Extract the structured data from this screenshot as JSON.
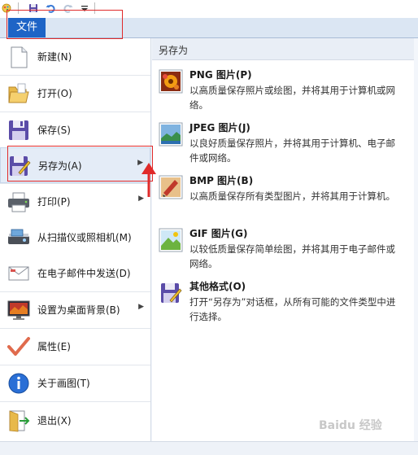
{
  "app": {
    "file_tab": "文件",
    "watermark": "Baidu 经验"
  },
  "quick_access": {
    "icons": [
      "paint-app-icon",
      "save-icon",
      "undo-icon",
      "redo-icon",
      "dropdown-icon"
    ]
  },
  "menu": {
    "items": [
      {
        "label": "新建(N)",
        "icon": "new-file-icon"
      },
      {
        "label": "打开(O)",
        "icon": "open-folder-icon"
      },
      {
        "label": "保存(S)",
        "icon": "save-icon"
      },
      {
        "label": "另存为(A)",
        "icon": "save-as-icon",
        "submenu": true
      },
      {
        "label": "打印(P)",
        "icon": "printer-icon",
        "submenu": true
      },
      {
        "label": "从扫描仪或照相机(M)",
        "icon": "scanner-icon"
      },
      {
        "label": "在电子邮件中发送(D)",
        "icon": "email-icon"
      },
      {
        "label": "设置为桌面背景(B)",
        "icon": "desktop-icon",
        "submenu": true
      },
      {
        "label": "属性(E)",
        "icon": "checkmark-icon"
      },
      {
        "label": "关于画图(T)",
        "icon": "info-icon"
      },
      {
        "label": "退出(X)",
        "icon": "exit-icon"
      }
    ]
  },
  "save_as": {
    "heading": "另存为",
    "options": [
      {
        "title": "PNG 图片(P)",
        "desc": "以高质量保存照片或绘图，并将其用于计算机或网络。",
        "icon": "png-image-icon"
      },
      {
        "title": "JPEG 图片(J)",
        "desc": "以良好质量保存照片，并将其用于计算机、电子邮件或网络。",
        "icon": "jpeg-image-icon"
      },
      {
        "title": "BMP 图片(B)",
        "desc": "以高质量保存所有类型图片，并将其用于计算机。",
        "icon": "bmp-image-icon"
      },
      {
        "title": "GIF 图片(G)",
        "desc": "以较低质量保存简单绘图，并将其用于电子邮件或网络。",
        "icon": "gif-image-icon"
      },
      {
        "title": "其他格式(O)",
        "desc": "打开“另存为”对话框，从所有可能的文件类型中进行选择。",
        "icon": "other-formats-icon"
      }
    ]
  },
  "colors": {
    "file_tab": "#1e64c6",
    "highlight": "#e4ecf7",
    "annotation_red": "#e02a2a"
  }
}
